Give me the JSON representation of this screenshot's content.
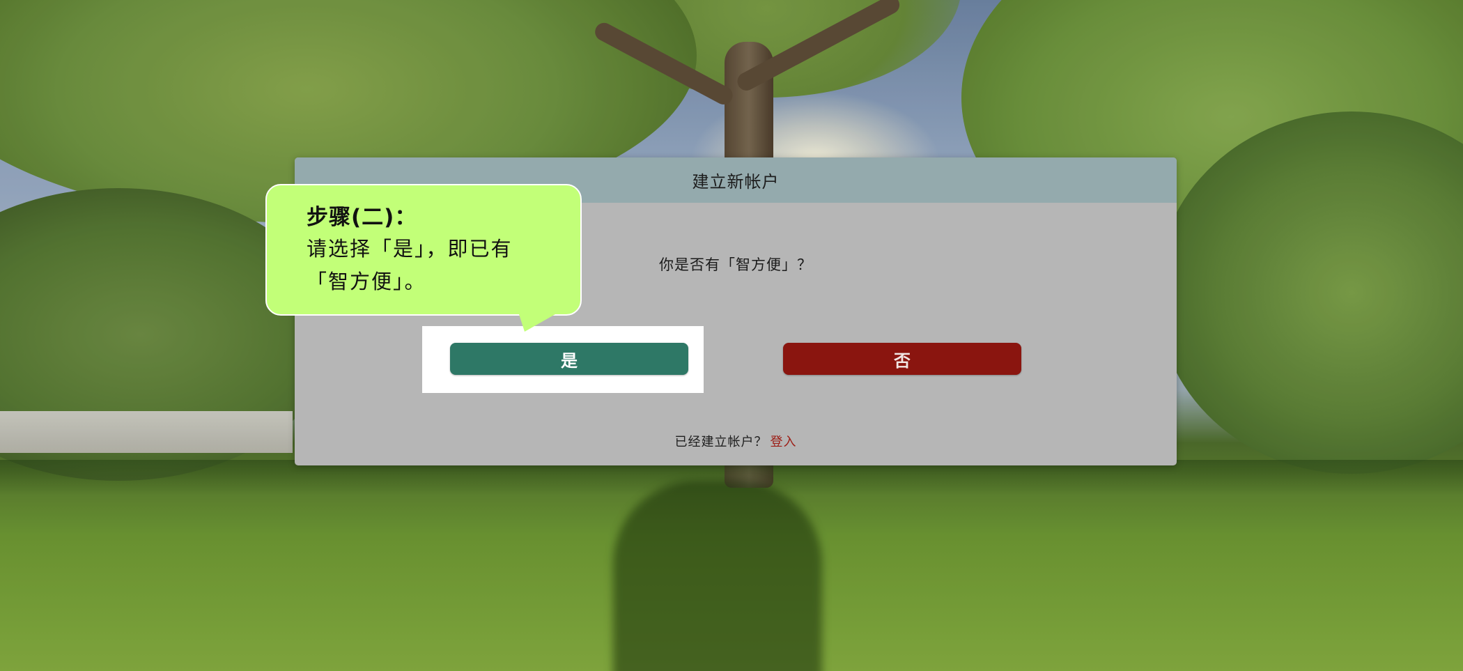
{
  "dialog": {
    "title": "建立新帐户",
    "question": "你是否有「智方便」？",
    "yes_label": "是",
    "no_label": "否",
    "footer_text": "已经建立帐户？",
    "login_label": "登入"
  },
  "callout": {
    "title": "步骤(二)：",
    "line1": "请选择「是」，即已有",
    "line2": "「智方便」。"
  },
  "colors": {
    "header_bg": "#94aaad",
    "dialog_bg": "#b6b6b6",
    "yes_button": "#2e7866",
    "no_button": "#8a150f",
    "callout_bg": "#c2ff78",
    "login_link": "#9c1c14"
  }
}
